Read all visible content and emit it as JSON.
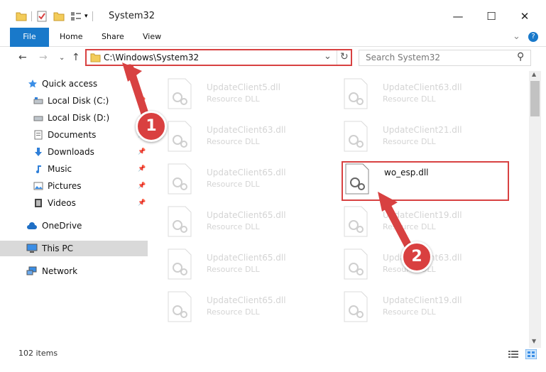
{
  "window": {
    "title": "System32",
    "minimize_glyph": "—",
    "maximize_glyph": "☐",
    "close_glyph": "✕"
  },
  "ribbon": {
    "tabs": [
      "File",
      "Home",
      "Share",
      "View"
    ],
    "help_glyph": "?"
  },
  "navigation": {
    "back_glyph": "←",
    "forward_glyph": "→",
    "recent_glyph": "⌄",
    "up_glyph": "↑",
    "address": "C:\\Windows\\System32",
    "dropdown_glyph": "⌄",
    "refresh_glyph": "↻",
    "search_placeholder": "Search System32",
    "search_icon": "⚲"
  },
  "sidebar": {
    "items": [
      {
        "label": "Quick access",
        "icon": "star-icon"
      },
      {
        "label": "Local Disk (C:)",
        "icon": "drive-icon"
      },
      {
        "label": "Local Disk (D:)",
        "icon": "drive-icon"
      },
      {
        "label": "Documents",
        "icon": "documents-icon"
      },
      {
        "label": "Downloads",
        "icon": "download-icon"
      },
      {
        "label": "Music",
        "icon": "music-icon"
      },
      {
        "label": "Pictures",
        "icon": "pictures-icon"
      },
      {
        "label": "Videos",
        "icon": "videos-icon"
      },
      {
        "label": "OneDrive",
        "icon": "cloud-icon"
      },
      {
        "label": "This PC",
        "icon": "computer-icon"
      },
      {
        "label": "Network",
        "icon": "network-icon"
      }
    ],
    "pin_glyph": "📌"
  },
  "files": [
    {
      "name": "UpdateClient5.dll",
      "type": "Resource DLL"
    },
    {
      "name": "UpdateClient63.dll",
      "type": "Resource DLL"
    },
    {
      "name": "UpdateClient63.dll",
      "type": "Resource DLL"
    },
    {
      "name": "UpdateClient21.dll",
      "type": "Resource DLL"
    },
    {
      "name": "UpdateClient65.dll",
      "type": "Resource DLL"
    },
    {
      "name": "wo_esp.dll",
      "type": ""
    },
    {
      "name": "UpdateClient65.dll",
      "type": "Resource DLL"
    },
    {
      "name": "UpdateClient19.dll",
      "type": "Resource DLL"
    },
    {
      "name": "UpdateClient65.dll",
      "type": "Resource DLL"
    },
    {
      "name": "UpdateClient63.dll",
      "type": "Resource DLL"
    },
    {
      "name": "UpdateClient65.dll",
      "type": "Resource DLL"
    },
    {
      "name": "UpdateClient19.dll",
      "type": "Resource DLL"
    }
  ],
  "status": {
    "item_count": "102 items"
  },
  "callouts": [
    "1",
    "2"
  ],
  "colors": {
    "accent": "#1979ca",
    "highlight": "#d84141"
  }
}
